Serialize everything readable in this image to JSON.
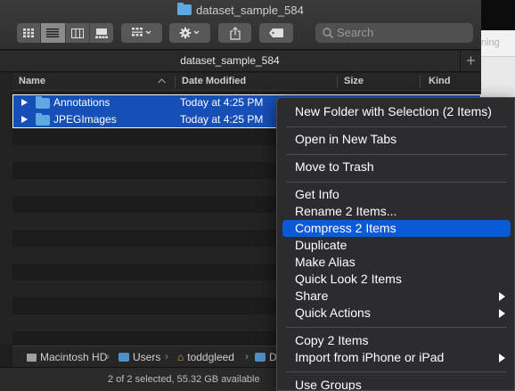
{
  "window": {
    "title": "dataset_sample_584",
    "tab_label": "dataset_sample_584",
    "new_tab_label": "+"
  },
  "toolbar": {
    "view_modes": [
      "icon-view",
      "list-view",
      "column-view",
      "gallery-view"
    ],
    "active_view": "list-view",
    "search_placeholder": "Search"
  },
  "columns": {
    "name": "Name",
    "date_modified": "Date Modified",
    "size": "Size",
    "kind": "Kind"
  },
  "files": [
    {
      "name": "Annotations",
      "date_modified": "Today at 4:25 PM",
      "selected": true
    },
    {
      "name": "JPEGImages",
      "date_modified": "Today at 4:25 PM",
      "selected": true
    }
  ],
  "path_bar": [
    "Macintosh HD",
    "Users",
    "toddgleed",
    "D"
  ],
  "status_bar": "2 of 2 selected, 55.32 GB available",
  "background_window_text": "ning",
  "context_menu": {
    "groups": [
      [
        {
          "label": "New Folder with Selection (2 Items)"
        }
      ],
      [
        {
          "label": "Open in New Tabs"
        }
      ],
      [
        {
          "label": "Move to Trash"
        }
      ],
      [
        {
          "label": "Get Info"
        },
        {
          "label": "Rename 2 Items..."
        },
        {
          "label": "Compress 2 Items",
          "highlighted": true
        },
        {
          "label": "Duplicate"
        },
        {
          "label": "Make Alias"
        },
        {
          "label": "Quick Look 2 Items"
        },
        {
          "label": "Share",
          "submenu": true
        },
        {
          "label": "Quick Actions",
          "submenu": true
        }
      ],
      [
        {
          "label": "Copy 2 Items"
        },
        {
          "label": "Import from iPhone or iPad",
          "submenu": true
        }
      ],
      [
        {
          "label": "Use Groups"
        }
      ]
    ]
  },
  "colors": {
    "selection": "#1650b7",
    "menu_highlight": "#0a5ad7",
    "folder": "#5fa8e0"
  }
}
